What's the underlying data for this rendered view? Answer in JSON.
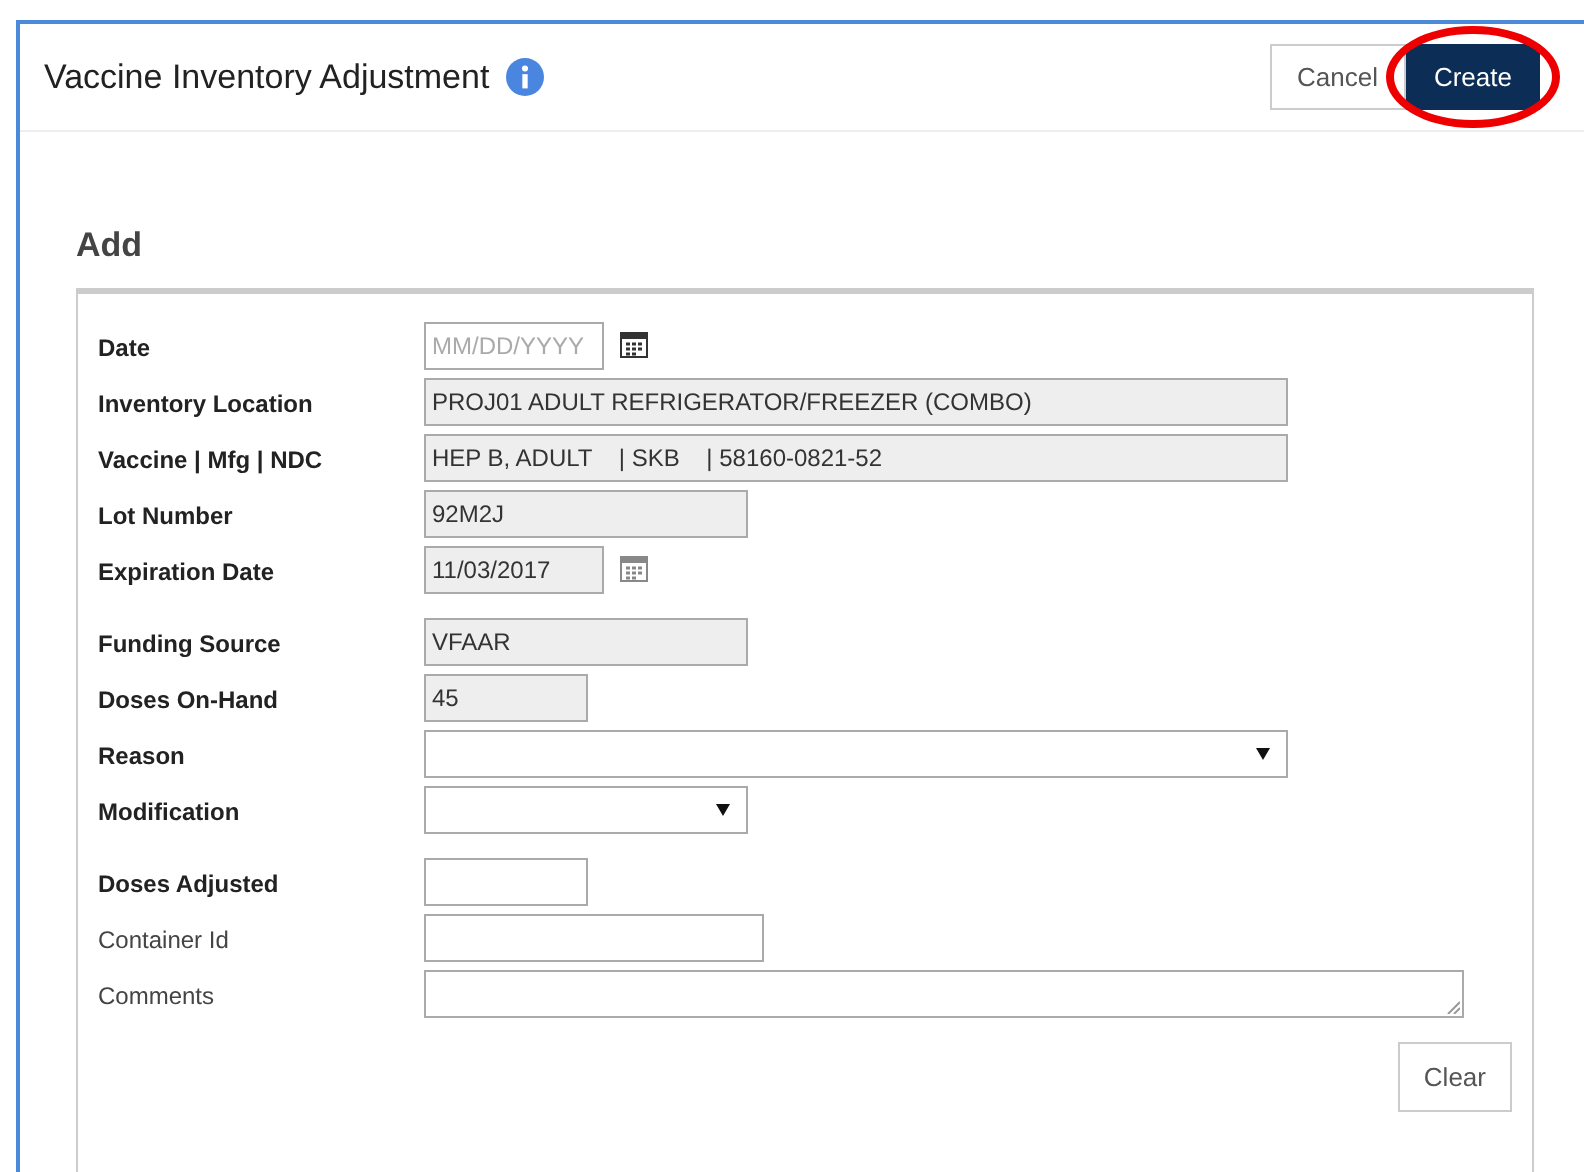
{
  "dialog": {
    "title": "Vaccine Inventory Adjustment",
    "buttons": [
      {
        "label": "Cancel",
        "primary": false,
        "highlighted": false
      },
      {
        "label": "Create",
        "primary": true,
        "highlighted": true
      }
    ]
  },
  "section": {
    "title": "Add",
    "field_groups": [
      [
        {
          "label": "Date",
          "required": true,
          "kind": "date",
          "readonly": false,
          "placeholder": "MM/DD/YYYY"
        },
        {
          "label": "Inventory Location",
          "required": true,
          "kind": "text",
          "readonly": true,
          "value": "PROJ01 ADULT REFRIGERATOR/FREEZER (COMBO)"
        },
        {
          "label": "Vaccine | Mfg | NDC",
          "required": true,
          "kind": "text",
          "readonly": true,
          "value": "HEP B, ADULT    | SKB    | 58160-0821-52"
        },
        {
          "label": "Lot Number",
          "required": true,
          "kind": "text",
          "readonly": true,
          "value": "92M2J"
        },
        {
          "label": "Expiration Date",
          "required": true,
          "kind": "date",
          "readonly": true,
          "value": "11/03/2017"
        }
      ],
      [
        {
          "label": "Funding Source",
          "required": true,
          "kind": "text",
          "readonly": true,
          "value": "VFAAR"
        },
        {
          "label": "Doses On-Hand",
          "required": true,
          "kind": "text",
          "readonly": true,
          "value": "45"
        },
        {
          "label": "Reason",
          "required": true,
          "kind": "select",
          "readonly": false
        },
        {
          "label": "Modification",
          "required": true,
          "kind": "select",
          "readonly": false
        }
      ],
      [
        {
          "label": "Doses Adjusted",
          "required": true,
          "kind": "text",
          "readonly": false
        },
        {
          "label": "Container Id",
          "required": false,
          "kind": "text",
          "readonly": false
        },
        {
          "label": "Comments",
          "required": false,
          "kind": "textarea",
          "readonly": false
        }
      ]
    ],
    "clear_button": "Clear"
  }
}
